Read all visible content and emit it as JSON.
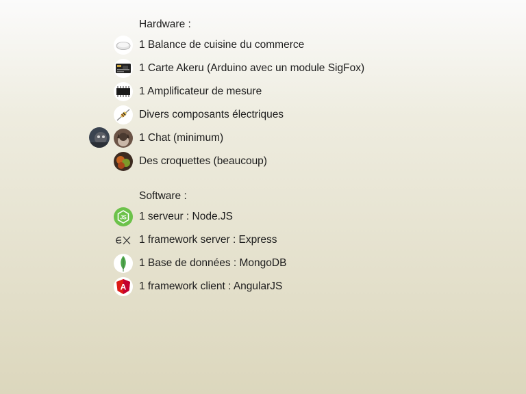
{
  "hardware": {
    "heading": "Hardware :",
    "items": [
      {
        "label": "1 Balance de cuisine du commerce",
        "icon": "kitchen-scale-icon"
      },
      {
        "label": "1 Carte Akeru (Arduino avec un module SigFox)",
        "icon": "arduino-board-icon"
      },
      {
        "label": "1 Amplificateur de mesure",
        "icon": "chip-icon"
      },
      {
        "label": "Divers composants électriques",
        "icon": "resistor-icon"
      },
      {
        "label": "1 Chat (minimum)",
        "icon": "cat-icon"
      },
      {
        "label": "Des croquettes (beaucoup)",
        "icon": "croquettes-icon"
      }
    ]
  },
  "software": {
    "heading": "Software :",
    "items": [
      {
        "label": "1 serveur : Node.JS",
        "icon": "nodejs-icon"
      },
      {
        "label": "1 framework server : Express",
        "icon": "express-icon"
      },
      {
        "label": "1 Base de données : MongoDB",
        "icon": "mongodb-icon"
      },
      {
        "label": "1 framework client : AngularJS",
        "icon": "angularjs-icon"
      }
    ]
  },
  "colors": {
    "nodejs": "#6cc24a",
    "mongodb": "#4fa94d",
    "angular": "#dd1b16"
  }
}
